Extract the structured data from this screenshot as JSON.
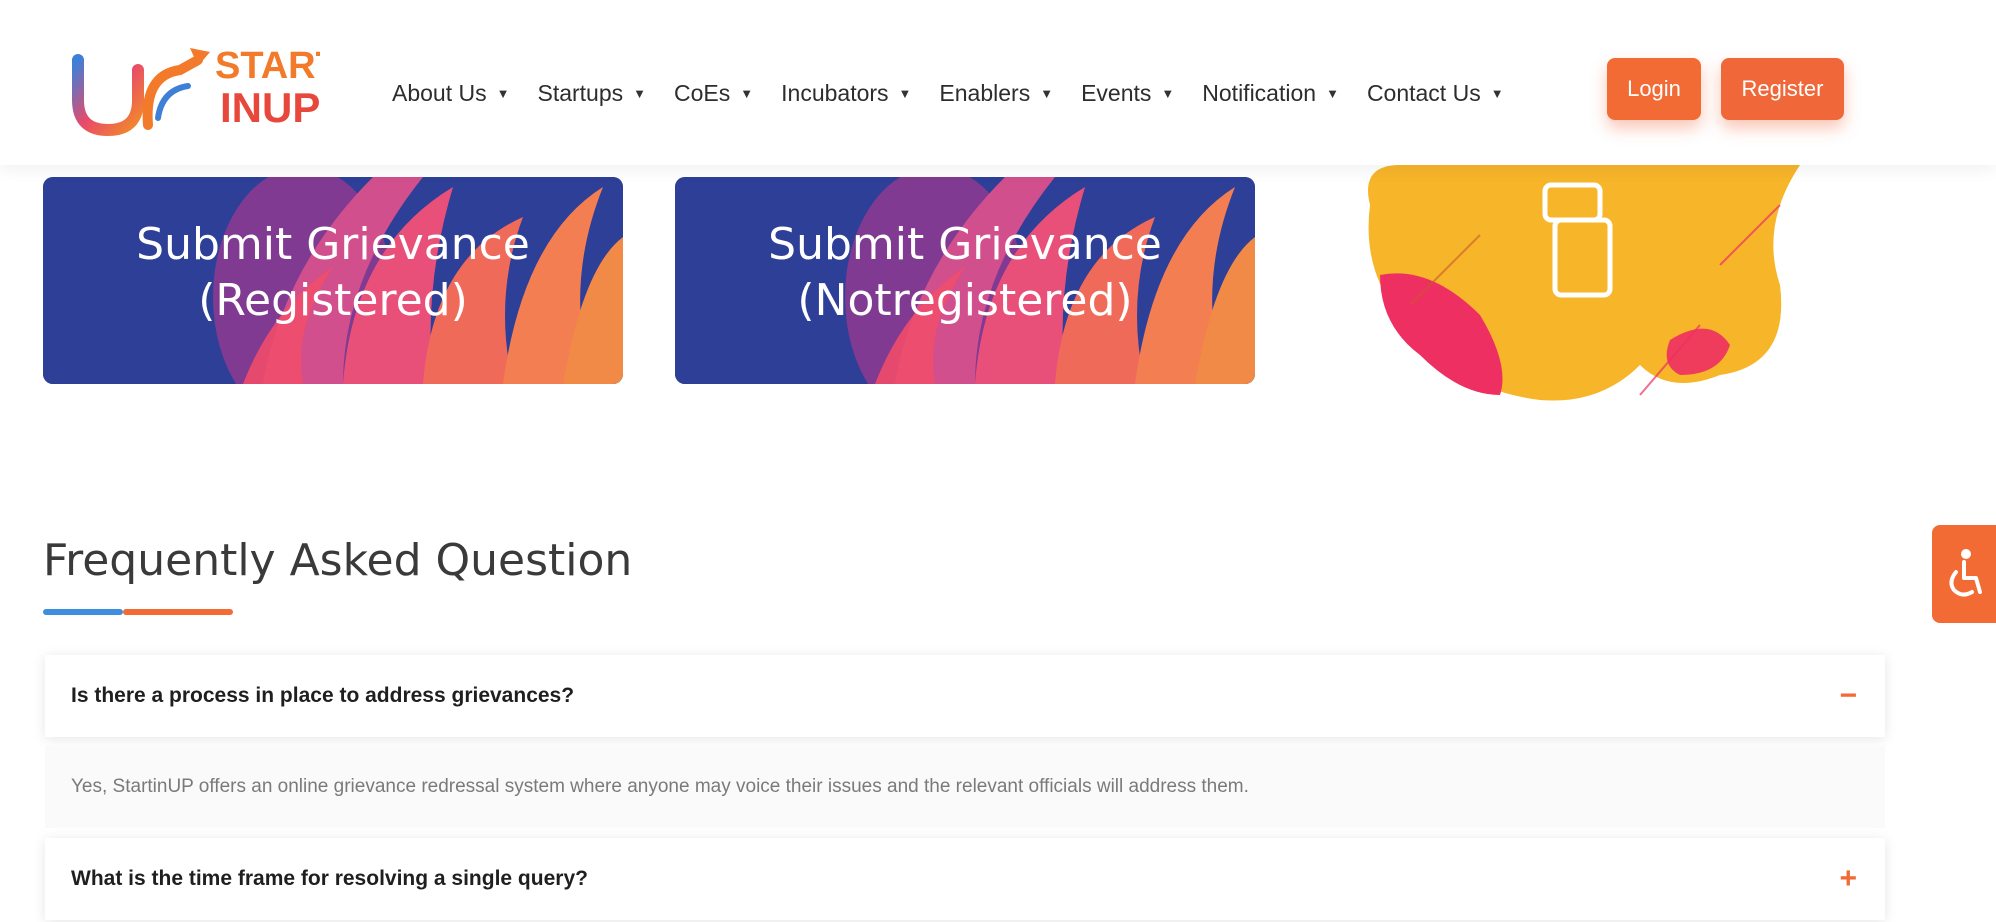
{
  "header": {
    "logo": {
      "text_top": "START",
      "text_bottom": "INUP"
    },
    "nav": [
      {
        "label": "About Us"
      },
      {
        "label": "Startups"
      },
      {
        "label": "CoEs"
      },
      {
        "label": "Incubators"
      },
      {
        "label": "Enablers"
      },
      {
        "label": "Events"
      },
      {
        "label": "Notification"
      },
      {
        "label": "Contact Us"
      }
    ],
    "login_label": "Login",
    "register_label": "Register"
  },
  "cards": [
    {
      "line1": "Submit Grievance",
      "line2": "(Registered)"
    },
    {
      "line1": "Submit Grievance",
      "line2": "(Notregistered)"
    }
  ],
  "faq": {
    "title": "Frequently Asked Question",
    "items": [
      {
        "question": "Is there a process in place to address grievances?",
        "icon": "minus-icon",
        "answer": "Yes, StartinUP offers an online grievance redressal system where anyone may voice their issues and the relevant officials will address them."
      },
      {
        "question": "What is the time frame for resolving a single query?",
        "icon": "plus-icon"
      }
    ]
  },
  "colors": {
    "accent": "#f26a34",
    "card_bg": "#2e3f97",
    "underline_blue": "#3e8ede"
  },
  "accessibility": {
    "icon": "accessibility-icon"
  }
}
